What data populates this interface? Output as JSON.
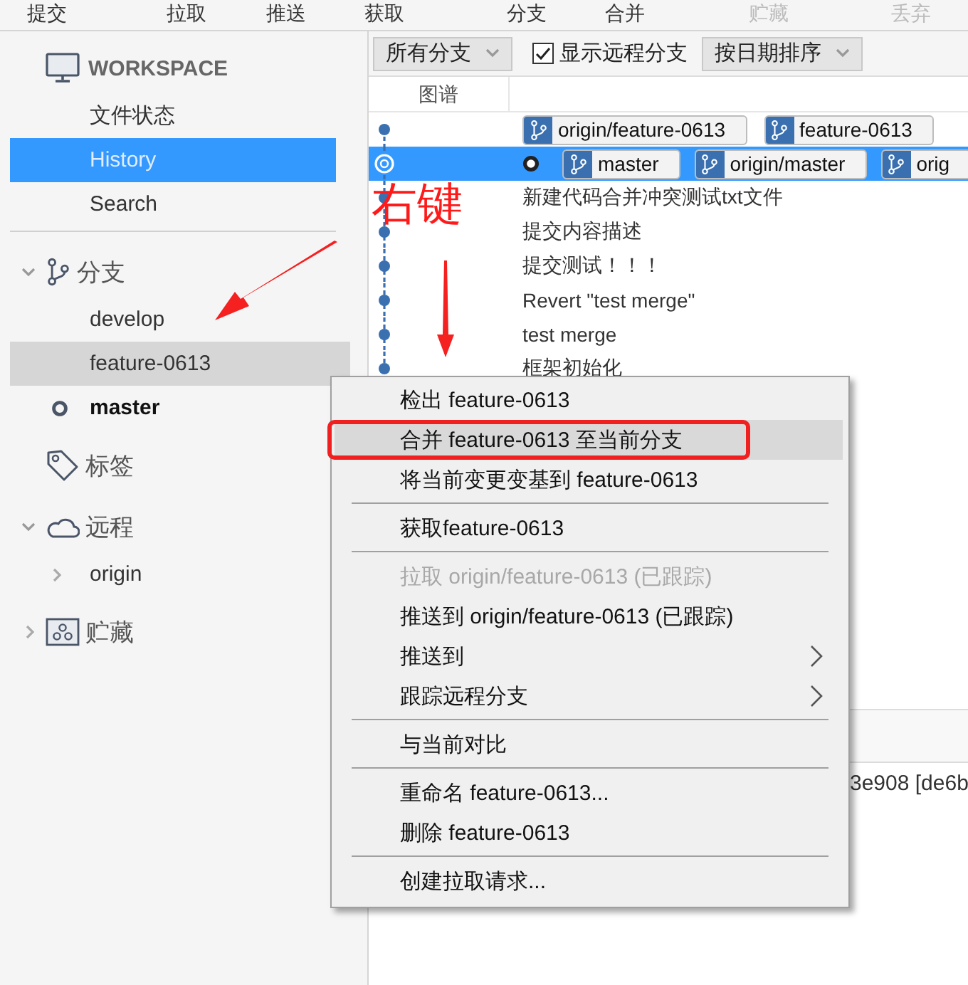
{
  "toolbar": [
    {
      "label": "提交",
      "disabled": false
    },
    {
      "label": "拉取",
      "disabled": false
    },
    {
      "label": "推送",
      "disabled": false
    },
    {
      "label": "获取",
      "disabled": false
    },
    {
      "label": "分支",
      "disabled": false
    },
    {
      "label": "合并",
      "disabled": false
    },
    {
      "label": "贮藏",
      "disabled": true
    },
    {
      "label": "丢弃",
      "disabled": true
    }
  ],
  "sidebar": {
    "workspace": {
      "title": "WORKSPACE",
      "items": [
        {
          "label": "文件状态",
          "selected": false
        },
        {
          "label": "History",
          "selected": true
        },
        {
          "label": "Search",
          "selected": false
        }
      ]
    },
    "sections": [
      {
        "kind": "branches",
        "title": "分支",
        "expanded": true,
        "children": [
          {
            "label": "develop",
            "selected": false,
            "current": false
          },
          {
            "label": "feature-0613",
            "selected": true,
            "current": false
          },
          {
            "label": "master",
            "selected": false,
            "current": true
          }
        ]
      },
      {
        "kind": "tags",
        "title": "标签"
      },
      {
        "kind": "remotes",
        "title": "远程",
        "expanded": true,
        "children": [
          {
            "label": "origin",
            "expanded": false
          }
        ]
      },
      {
        "kind": "stashes",
        "title": "贮藏",
        "expanded": false
      }
    ]
  },
  "history": {
    "branch_filter": "所有分支",
    "show_remote": {
      "label": "显示远程分支",
      "checked": true
    },
    "sort": "按日期排序",
    "columns": [
      "图谱"
    ],
    "rows": [
      {
        "selected": false,
        "current": false,
        "refs": [
          "origin/feature-0613",
          "feature-0613"
        ]
      },
      {
        "selected": true,
        "current": true,
        "refs": [
          "master",
          "origin/master",
          "orig"
        ]
      },
      {
        "selected": false,
        "current": false,
        "message": "新建代码合并冲突测试txt文件"
      },
      {
        "selected": false,
        "current": false,
        "message": "提交内容描述"
      },
      {
        "selected": false,
        "current": false,
        "message": "提交测试！！！"
      },
      {
        "selected": false,
        "current": false,
        "message": "Revert \"test merge\""
      },
      {
        "selected": false,
        "current": false,
        "message": "test merge"
      },
      {
        "selected": false,
        "current": false,
        "message": "框架初始化"
      }
    ],
    "detail_text": "3e908 [de6b"
  },
  "context_menu": {
    "items": [
      {
        "kind": "item",
        "label": "检出 feature-0613",
        "highlighted": false,
        "disabled": false,
        "submenu": false,
        "annotated": false
      },
      {
        "kind": "item",
        "label": "合并 feature-0613 至当前分支",
        "highlighted": true,
        "disabled": false,
        "submenu": false,
        "annotated": true
      },
      {
        "kind": "item",
        "label": "将当前变更变基到 feature-0613",
        "highlighted": false,
        "disabled": false,
        "submenu": false,
        "annotated": false
      },
      {
        "kind": "separator"
      },
      {
        "kind": "item",
        "label": "获取feature-0613",
        "highlighted": false,
        "disabled": false,
        "submenu": false,
        "annotated": false
      },
      {
        "kind": "separator"
      },
      {
        "kind": "item",
        "label": "拉取 origin/feature-0613 (已跟踪)",
        "highlighted": false,
        "disabled": true,
        "submenu": false,
        "annotated": false
      },
      {
        "kind": "item",
        "label": "推送到 origin/feature-0613 (已跟踪)",
        "highlighted": false,
        "disabled": false,
        "submenu": false,
        "annotated": false
      },
      {
        "kind": "item",
        "label": "推送到",
        "highlighted": false,
        "disabled": false,
        "submenu": true,
        "annotated": false
      },
      {
        "kind": "item",
        "label": "跟踪远程分支",
        "highlighted": false,
        "disabled": false,
        "submenu": true,
        "annotated": false
      },
      {
        "kind": "separator"
      },
      {
        "kind": "item",
        "label": "与当前对比",
        "highlighted": false,
        "disabled": false,
        "submenu": false,
        "annotated": false
      },
      {
        "kind": "separator"
      },
      {
        "kind": "item",
        "label": "重命名 feature-0613...",
        "highlighted": false,
        "disabled": false,
        "submenu": false,
        "annotated": false
      },
      {
        "kind": "item",
        "label": "删除 feature-0613",
        "highlighted": false,
        "disabled": false,
        "submenu": false,
        "annotated": false
      },
      {
        "kind": "separator"
      },
      {
        "kind": "item",
        "label": "创建拉取请求...",
        "highlighted": false,
        "disabled": false,
        "submenu": false,
        "annotated": false
      }
    ]
  },
  "annotation": {
    "label": "右键"
  }
}
